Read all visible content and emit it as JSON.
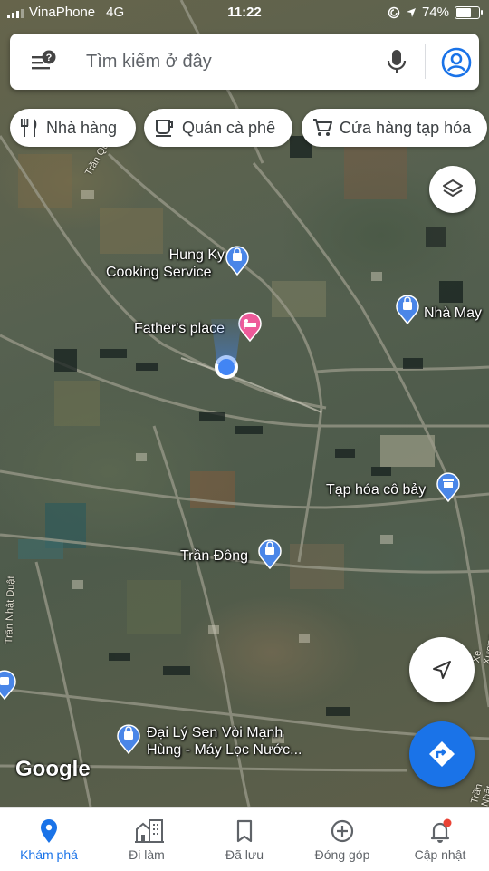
{
  "status_bar": {
    "carrier": "VinaPhone",
    "network": "4G",
    "time": "11:22",
    "battery": "74%",
    "battery_level": 0.74
  },
  "search": {
    "placeholder": "Tìm kiếm ở đây",
    "menu_icon": "menu-help-icon",
    "mic_icon": "mic-icon",
    "account_icon": "account-icon"
  },
  "chips": [
    {
      "label": "Nhà hàng",
      "icon": "fork-knife-icon"
    },
    {
      "label": "Quán cà phê",
      "icon": "coffee-cup-icon"
    },
    {
      "label": "Cửa hàng tạp hóa",
      "icon": "shopping-cart-icon"
    }
  ],
  "map": {
    "places": [
      {
        "name": "Hung Ky Cooking Service",
        "line1": "Hung Ky",
        "line2": "Cooking Service",
        "type": "shopping-bag-icon"
      },
      {
        "name": "Father's place",
        "type": "hotel-bed-icon"
      },
      {
        "name": "Nhà May",
        "type": "shopping-bag-icon"
      },
      {
        "name": "Tạp hóa cô bảy",
        "type": "store-icon"
      },
      {
        "name": "Trần Đông",
        "type": "shopping-bag-icon"
      },
      {
        "name": "Đại Lý Sen Vòi Mạnh Hùng - Máy Lọc Nước...",
        "line1": "Đại Lý Sen Vòi Mạnh",
        "line2": "Hùng - Máy Lọc Nước...",
        "type": "shopping-bag-icon"
      }
    ],
    "streets": [
      "Trần Quý Cáp",
      "Trần Nhật Duật",
      "Xe Xương",
      "Trần Nhật"
    ],
    "attribution": "Google",
    "colors": {
      "accent": "#1a73e8",
      "pin_blue": "#4a86e8",
      "hotel_pink": "#ee5a9a"
    }
  },
  "bottom_nav": [
    {
      "label": "Khám phá",
      "icon": "explore-pin-icon",
      "active": true
    },
    {
      "label": "Đi làm",
      "icon": "commute-building-icon",
      "active": false
    },
    {
      "label": "Đã lưu",
      "icon": "bookmark-icon",
      "active": false
    },
    {
      "label": "Đóng góp",
      "icon": "add-circle-icon",
      "active": false
    },
    {
      "label": "Cập nhật",
      "icon": "bell-icon",
      "active": false,
      "badge": true
    }
  ]
}
